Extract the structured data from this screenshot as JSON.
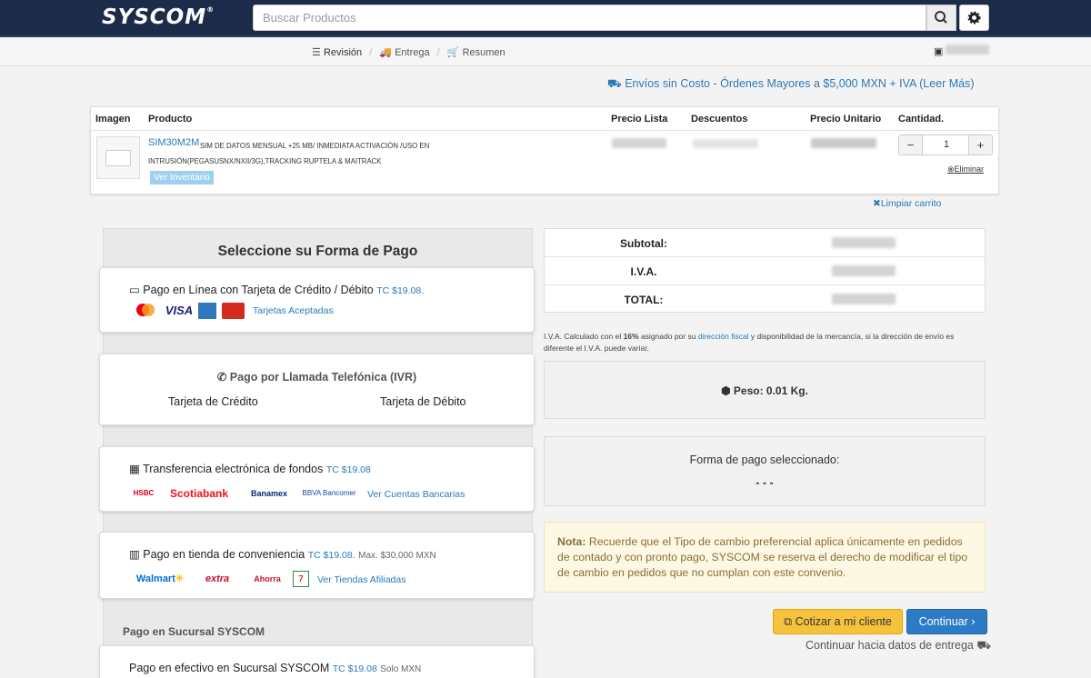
{
  "header": {
    "logo": "SYSCOM",
    "search_placeholder": "Buscar Productos",
    "search_icon": "search-icon",
    "settings_icon": "gear-icon"
  },
  "steps": [
    {
      "label": "Revisión",
      "icon": "list-icon"
    },
    {
      "label": "Entrega",
      "icon": "truck-icon"
    },
    {
      "label": "Resumen",
      "icon": "cart-icon"
    }
  ],
  "shipping_banner": "Envíos sin Costo - Órdenes Mayores a $5,000 MXN + IVA (Leer Más)",
  "cart": {
    "columns": [
      "Imagen",
      "Producto",
      "Precio Lista",
      "Descuentos",
      "Precio Unitario",
      "Cantidad."
    ],
    "item": {
      "sku": "SIM30M2M",
      "description": "SIM DE DATOS MENSUAL +25 MB/ INMEDIATA ACTIVACIÓN /USO EN INTRUSIÓN(PEGASUSNX/NXII/3G),TRACKING RUPTELA & MAITRACK",
      "inventory_button": "Ver Inventario",
      "quantity": "1",
      "remove_label": "Eliminar"
    },
    "clear_label": "Limpiar carrito"
  },
  "payment": {
    "title": "Seleccione su Forma de Pago",
    "card": {
      "label": "Pago en Línea con Tarjeta de Crédito / Débito",
      "tc": "TC $19.08.",
      "link": "Tarjetas Aceptadas",
      "brands": [
        "VISA"
      ]
    },
    "ivr": {
      "label": "Pago por Llamada Telefónica (IVR)",
      "credit": "Tarjeta de Crédito",
      "debit": "Tarjeta de Débito"
    },
    "transfer": {
      "label": "Transferencia electrónica de fondos",
      "tc": "TC $19.08",
      "banks": [
        "HSBC",
        "Scotiabank",
        "Banamex",
        "BBVA Bancomer"
      ],
      "link": "Ver Cuentas Bancarias"
    },
    "store": {
      "label": "Pago en tienda de conveniencia",
      "tc": "TC $19.08.",
      "max": "Max. $30,000 MXN",
      "stores": [
        "Walmart",
        "extra",
        "Ahorra"
      ],
      "link": "Ver Tiendas Afiliadas"
    },
    "branch_section": "Pago en Sucursal SYSCOM",
    "branch": {
      "label": "Pago en efectivo en Sucursal SYSCOM",
      "tc": "TC $19.08",
      "note": "Solo MXN"
    }
  },
  "totals": {
    "rows": [
      {
        "label": "Subtotal:"
      },
      {
        "label": "I.V.A."
      },
      {
        "label": "TOTAL:"
      }
    ],
    "iva_note_prefix": "I.V.A. Calculado con el ",
    "iva_pct": "16%",
    "iva_note_mid": " asignado por su ",
    "iva_link": "dirección fiscal",
    "iva_note_suffix": " y disponibilidad de la mercancía, si la dirección de envío es diferente el I.V.A. puede variar."
  },
  "weight": "Peso: 0.01 Kg.",
  "selected_payment": {
    "label": "Forma de pago seleccionado:",
    "value": "- - -"
  },
  "note": {
    "title": "Nota:",
    "text": " Recuerde que el Tipo de cambio preferencial aplica únicamente en pedidos de contado y con pronto pago, SYSCOM se reserva el derecho de modificar el tipo de cambio en pedidos que no cumplan con este convenio."
  },
  "actions": {
    "quote": "Cotizar a mi cliente",
    "continue": "Continuar",
    "continue_note": "Continuar hacia datos de entrega"
  },
  "colors": {
    "header_bg": "#1d2b4a",
    "link": "#2a7ab8",
    "primary": "#2c7bc4",
    "warning": "#f6c23e"
  }
}
